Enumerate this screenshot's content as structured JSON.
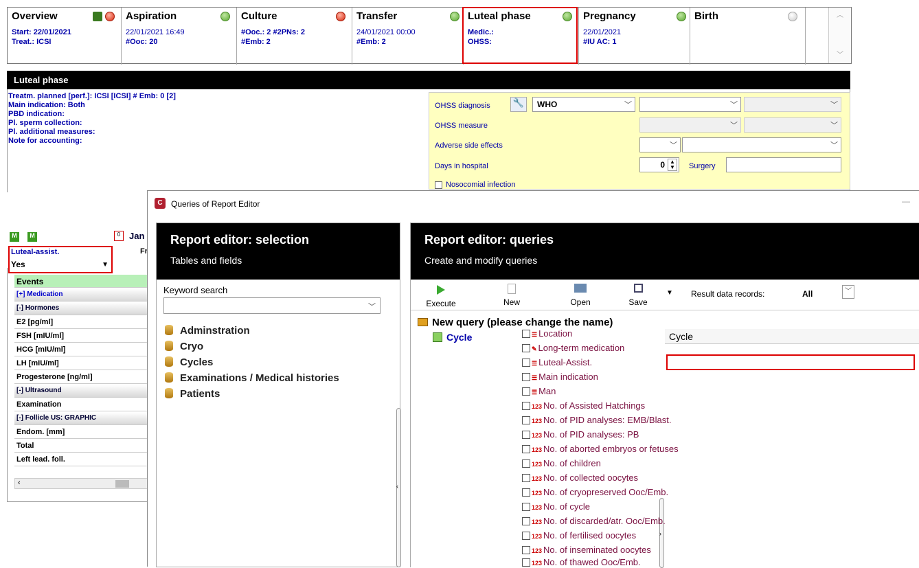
{
  "tabs": [
    {
      "label": "Overview",
      "lines": [
        "Start: 22/01/2021",
        "Treat.: ICSI"
      ]
    },
    {
      "label": "Aspiration",
      "lines": [
        "22/01/2021 16:49",
        "#Ooc: 20"
      ]
    },
    {
      "label": "Culture",
      "lines": [
        "#Ooc.: 2 #2PNs: 2",
        "#Emb: 2"
      ]
    },
    {
      "label": "Transfer",
      "lines": [
        "24/01/2021 00:00",
        "#Emb: 2"
      ]
    },
    {
      "label": "Luteal phase",
      "lines": [
        "Medic.:",
        "OHSS:"
      ]
    },
    {
      "label": "Pregnancy",
      "lines": [
        "22/01/2021",
        "#IU AC: 1"
      ]
    },
    {
      "label": "Birth",
      "lines": []
    }
  ],
  "luteal": {
    "title": "Luteal phase",
    "info": [
      "Treatm. planned  [perf.]:  ICSI   [ICSI]     # Emb:  0    [2]",
      "Main indication:  Both",
      "PBD indication:",
      "Pl. sperm collection:",
      "Pl. additional measures:",
      "Note for accounting:"
    ],
    "ohss_diagnosis": "OHSS diagnosis",
    "ohss_value": "WHO",
    "ohss_measure": "OHSS measure",
    "adverse": "Adverse side effects",
    "days_hospital": "Days in hospital",
    "days_value": "0",
    "surgery": "Surgery",
    "nosocomial": "Nosocomial infection"
  },
  "left": {
    "date_partial": "Jan",
    "fr": "Fr",
    "luteal_assist_label": "Luteal-assist.",
    "luteal_assist_value": "Yes",
    "rows": [
      "Events",
      "[+] Medication",
      "[-] Hormones",
      "E2 [pg/ml]",
      "FSH [mIU/ml]",
      "HCG [mIU/ml]",
      "LH [mIU/ml]",
      "Progesterone [ng/ml]",
      "[-] Ultrasound",
      "Examination",
      "[-] Follicle US: GRAPHIC",
      "Endom. [mm]",
      "Total",
      "Left lead. foll."
    ]
  },
  "dialog": {
    "title": "Queries of Report Editor",
    "sel_title": "Report editor: selection",
    "sel_sub": "Tables and fields",
    "keyword": "Keyword search",
    "tables": [
      "Adminstration",
      "Cryo",
      "Cycles",
      "Examinations / Medical histories",
      "Patients"
    ],
    "q_title": "Report editor: queries",
    "q_sub": "Create and modify queries",
    "toolbar": {
      "execute": "Execute",
      "new": "New",
      "open": "Open",
      "save": "Save"
    },
    "result_label": "Result data records:",
    "result_value": "All",
    "query_name": "New query (please change the name)",
    "query_child": "Cycle",
    "field_header": "Cycle",
    "fields": [
      "Location",
      "Long-term medication",
      "Luteal-Assist.",
      "Main indication",
      "Man",
      "No. of Assisted Hatchings",
      "No. of PID analyses: EMB/Blast.",
      "No. of PID analyses: PB",
      "No. of aborted embryos or fetuses",
      "No. of children",
      "No. of collected oocytes",
      "No. of cryopreserved Ooc/Emb.",
      "No. of cycle",
      "No. of discarded/atr. Ooc/Emb.",
      "No. of fertilised oocytes",
      "No. of inseminated oocytes",
      "No. of thawed Ooc/Emb."
    ]
  }
}
